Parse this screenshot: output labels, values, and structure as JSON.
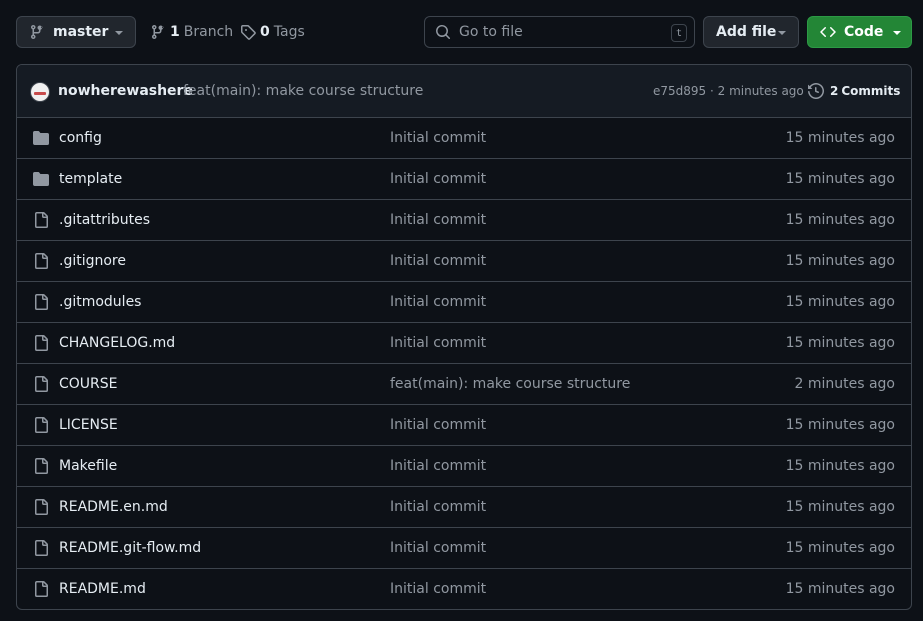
{
  "toolbar": {
    "branch_name": "master",
    "branches_count": "1",
    "branches_label": "Branch",
    "tags_count": "0",
    "tags_label": "Tags",
    "search_placeholder": "Go to file",
    "search_shortcut": "t",
    "add_file_label": "Add file",
    "code_label": "Code"
  },
  "latest_commit": {
    "author": "nowherewashere",
    "message": "feat(main): make course structure",
    "hash_time": "e75d895 · 2 minutes ago",
    "commits_count": "2",
    "commits_label": "Commits"
  },
  "files": [
    {
      "name": "config",
      "type": "folder",
      "message": "Initial commit",
      "age": "15 minutes ago"
    },
    {
      "name": "template",
      "type": "folder",
      "message": "Initial commit",
      "age": "15 minutes ago"
    },
    {
      "name": ".gitattributes",
      "type": "file",
      "message": "Initial commit",
      "age": "15 minutes ago"
    },
    {
      "name": ".gitignore",
      "type": "file",
      "message": "Initial commit",
      "age": "15 minutes ago"
    },
    {
      "name": ".gitmodules",
      "type": "file",
      "message": "Initial commit",
      "age": "15 minutes ago"
    },
    {
      "name": "CHANGELOG.md",
      "type": "file",
      "message": "Initial commit",
      "age": "15 minutes ago"
    },
    {
      "name": "COURSE",
      "type": "file",
      "message": "feat(main): make course structure",
      "age": "2 minutes ago"
    },
    {
      "name": "LICENSE",
      "type": "file",
      "message": "Initial commit",
      "age": "15 minutes ago"
    },
    {
      "name": "Makefile",
      "type": "file",
      "message": "Initial commit",
      "age": "15 minutes ago"
    },
    {
      "name": "README.en.md",
      "type": "file",
      "message": "Initial commit",
      "age": "15 minutes ago"
    },
    {
      "name": "README.git-flow.md",
      "type": "file",
      "message": "Initial commit",
      "age": "15 minutes ago"
    },
    {
      "name": "README.md",
      "type": "file",
      "message": "Initial commit",
      "age": "15 minutes ago"
    }
  ],
  "icons": {
    "branch": "git-branch-icon",
    "tag": "tag-icon",
    "search": "search-icon",
    "code": "code-icon",
    "history": "history-icon",
    "folder": "folder-icon",
    "file": "file-icon"
  },
  "colors": {
    "background": "#0d1117",
    "border": "#3d444d",
    "muted_text": "#9198a1",
    "primary_button": "#238636"
  }
}
